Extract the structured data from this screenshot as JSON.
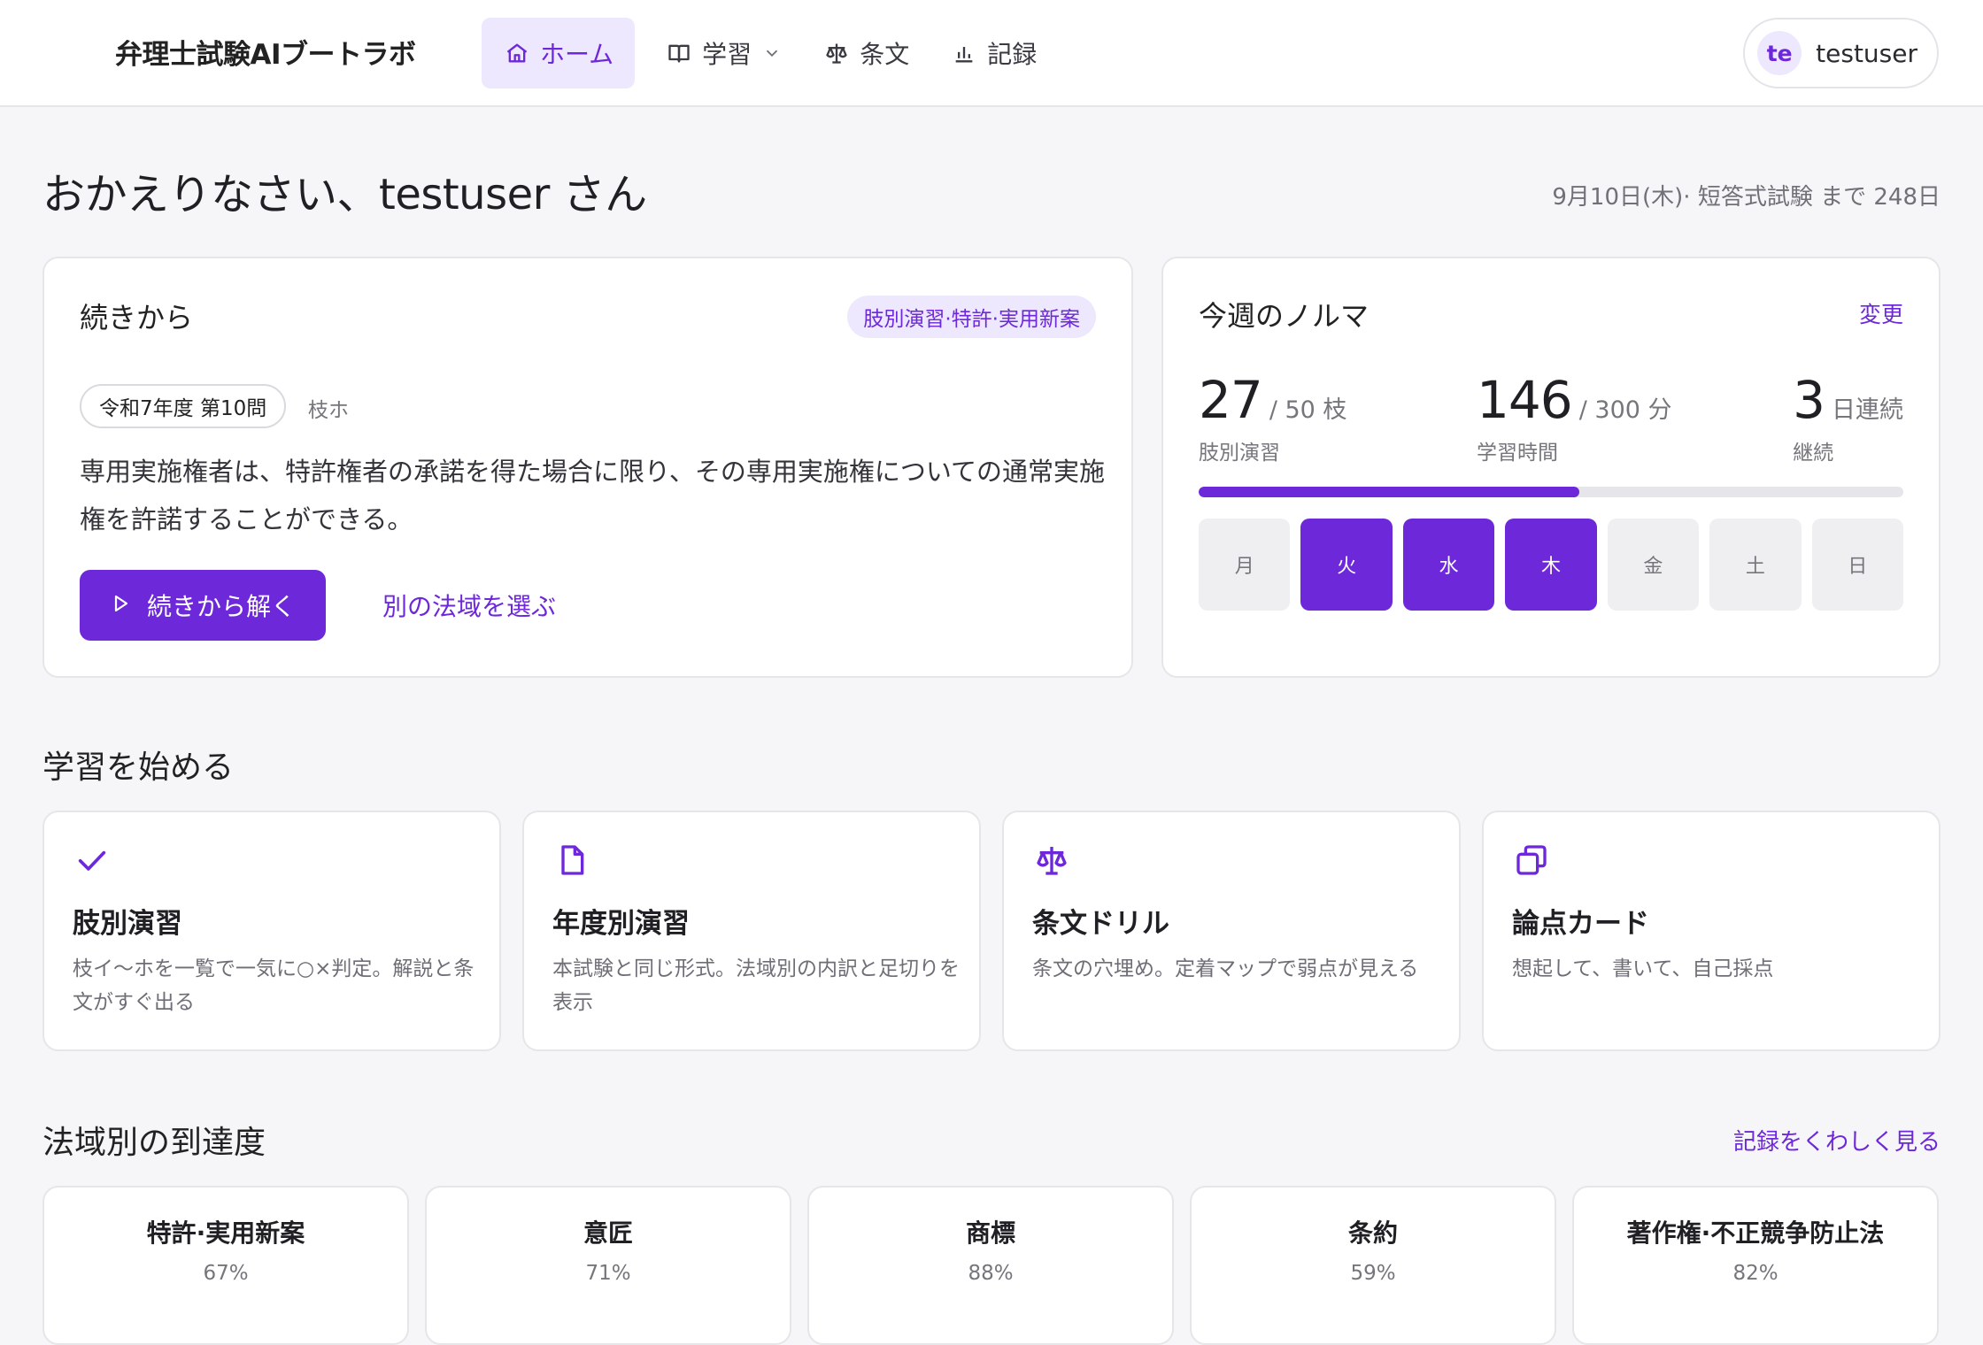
{
  "app": {
    "brand": "弁理士試験AIブートラボ"
  },
  "nav": {
    "home": "ホーム",
    "study": "学習",
    "articles": "条文",
    "records": "記録"
  },
  "user": {
    "initials": "te",
    "name": "testuser"
  },
  "welcome": {
    "greeting": "おかえりなさい、testuser さん",
    "countdown": "9月10日(木)· 短答式試験 まで 248日"
  },
  "continue": {
    "title": "続きから",
    "badge": "肢別演習·特許·実用新案",
    "question_tag": "令和7年度 第10問",
    "branch": "枝ホ",
    "question_text": "専用実施権者は、特許権者の承諾を得た場合に限り、その専用実施権についての通常実施権を許諾することができる。",
    "primary_button": "続きから解く",
    "secondary_link": "別の法域を選ぶ"
  },
  "quota": {
    "title": "今週のノルマ",
    "change": "変更",
    "stats": [
      {
        "value": "27",
        "unit": "/ 50 枝",
        "label": "肢別演習"
      },
      {
        "value": "146",
        "unit": "/ 300 分",
        "label": "学習時間"
      },
      {
        "value": "3",
        "unit": "日連続",
        "label": "継続"
      }
    ],
    "progress_fraction": 0.54,
    "days": [
      {
        "label": "月",
        "done": false
      },
      {
        "label": "火",
        "done": true
      },
      {
        "label": "水",
        "done": true
      },
      {
        "label": "木",
        "done": true
      },
      {
        "label": "金",
        "done": false
      },
      {
        "label": "土",
        "done": false
      },
      {
        "label": "日",
        "done": false
      }
    ]
  },
  "learn": {
    "title": "学習を始める",
    "cards": [
      {
        "icon": "check-icon",
        "title": "肢別演習",
        "desc": "枝イ〜ホを一覧で一気に○×判定。解説と条文がすぐ出る"
      },
      {
        "icon": "document-icon",
        "title": "年度別演習",
        "desc": "本試験と同じ形式。法域別の内訳と足切りを表示"
      },
      {
        "icon": "scale-icon",
        "title": "条文ドリル",
        "desc": "条文の穴埋め。定着マップで弱点が見える"
      },
      {
        "icon": "cards-icon",
        "title": "論点カード",
        "desc": "想起して、書いて、自己採点"
      }
    ]
  },
  "mastery": {
    "title": "法域別の到達度",
    "link": "記録をくわしく見る",
    "items": [
      {
        "name": "特許·実用新案",
        "percent": "67%"
      },
      {
        "name": "意匠",
        "percent": "71%"
      },
      {
        "name": "商標",
        "percent": "88%"
      },
      {
        "name": "条約",
        "percent": "59%"
      },
      {
        "name": "著作権·不正競争防止法",
        "percent": "82%"
      }
    ]
  },
  "colors": {
    "accent": "#6d28d9",
    "accent_soft": "#ede8fd",
    "background": "#f6f6f8"
  }
}
